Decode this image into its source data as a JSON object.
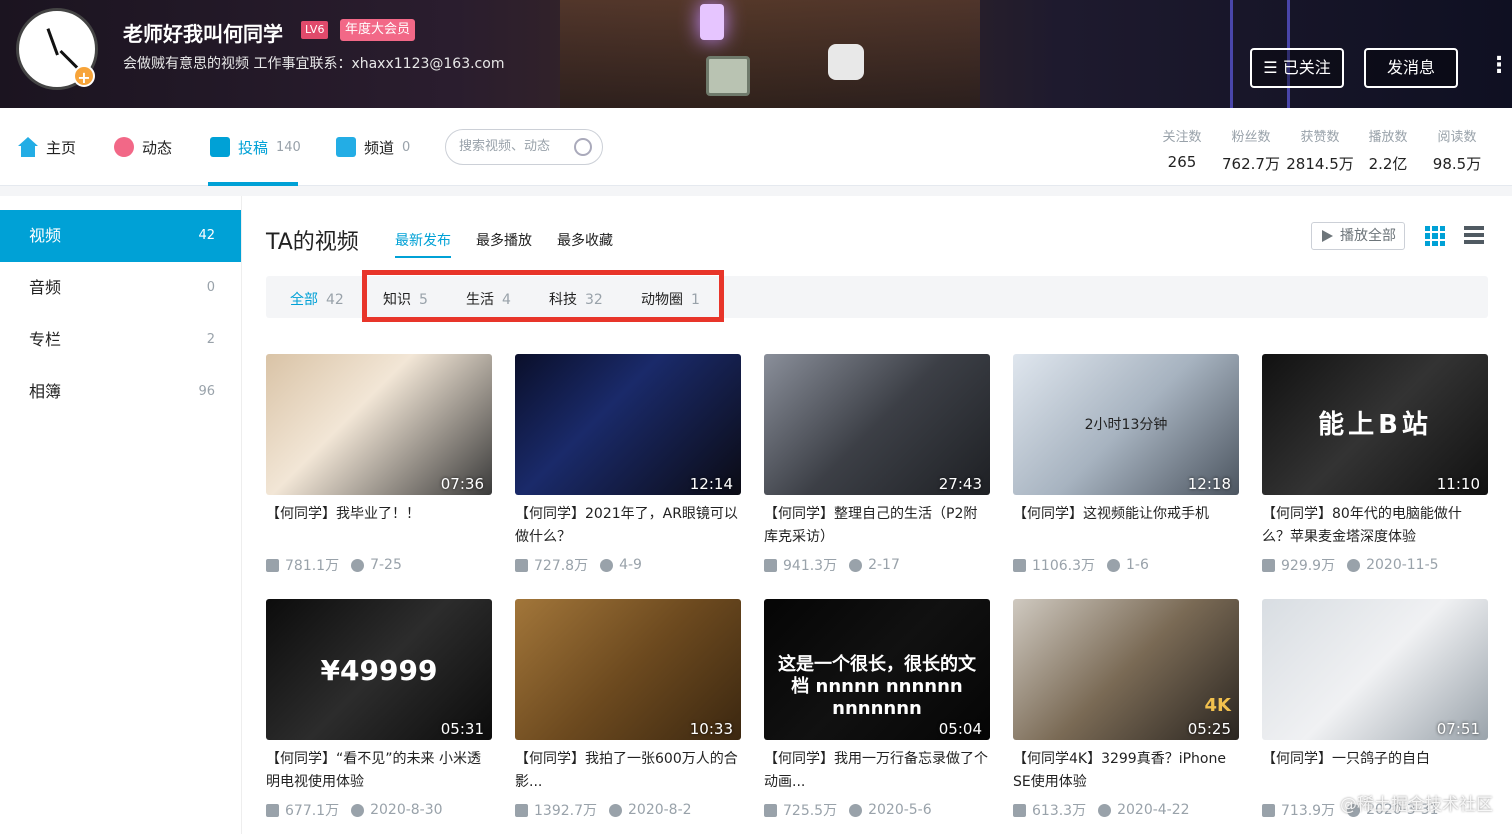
{
  "profile": {
    "name": "老师好我叫何同学",
    "level": "LV6",
    "vip": "年度大会员",
    "sign": "会做贼有意思的视频 工作事宜联系：xhaxx1123@163.com",
    "follow_label": "☰ 已关注",
    "message_label": "发消息",
    "more_label": "⋮"
  },
  "nav": {
    "home": "主页",
    "dynamic": "动态",
    "submit": "投稿",
    "submit_count": "140",
    "channel": "频道",
    "channel_count": "0",
    "search_placeholder": "搜索视频、动态"
  },
  "stats": [
    {
      "label": "关注数",
      "value": "265"
    },
    {
      "label": "粉丝数",
      "value": "762.7万"
    },
    {
      "label": "获赞数",
      "value": "2814.5万"
    },
    {
      "label": "播放数",
      "value": "2.2亿"
    },
    {
      "label": "阅读数",
      "value": "98.5万"
    }
  ],
  "sidebar": [
    {
      "label": "视频",
      "count": "42"
    },
    {
      "label": "音频",
      "count": "0"
    },
    {
      "label": "专栏",
      "count": "2"
    },
    {
      "label": "相簿",
      "count": "96"
    }
  ],
  "section": {
    "title": "TA的视频",
    "sorts": [
      "最新发布",
      "最多播放",
      "最多收藏"
    ],
    "play_all": "播放全部"
  },
  "filters": [
    {
      "label": "全部",
      "count": "42"
    },
    {
      "label": "知识",
      "count": "5"
    },
    {
      "label": "生活",
      "count": "4"
    },
    {
      "label": "科技",
      "count": "32"
    },
    {
      "label": "动物圈",
      "count": "1"
    }
  ],
  "videos": [
    {
      "title": "【何同学】我毕业了！！",
      "duration": "07:36",
      "plays": "781.1万",
      "date": "7-25"
    },
    {
      "title": "【何同学】2021年了，AR眼镜可以做什么？",
      "duration": "12:14",
      "plays": "727.8万",
      "date": "4-9"
    },
    {
      "title": "【何同学】整理自己的生活（P2附库克采访）",
      "duration": "27:43",
      "plays": "941.3万",
      "date": "2-17"
    },
    {
      "title": "【何同学】这视频能让你戒手机",
      "duration": "12:18",
      "plays": "1106.3万",
      "date": "1-6",
      "overlay": "2小时13分钟"
    },
    {
      "title": "【何同学】80年代的电脑能做什么？苹果麦金塔深度体验",
      "duration": "11:10",
      "plays": "929.9万",
      "date": "2020-11-5",
      "overlay": "能上B站"
    },
    {
      "title": "【何同学】“看不见”的未来 小米透明电视使用体验",
      "duration": "05:31",
      "plays": "677.1万",
      "date": "2020-8-30",
      "overlay": "¥49999"
    },
    {
      "title": "【何同学】我拍了一张600万人的合影...",
      "duration": "10:33",
      "plays": "1392.7万",
      "date": "2020-8-2"
    },
    {
      "title": "【何同学】我用一万行备忘录做了个动画...",
      "duration": "05:04",
      "plays": "725.5万",
      "date": "2020-5-6",
      "overlay": "这是一个很长，很长的文档 nnnnn nnnnnn nnnnnnn"
    },
    {
      "title": "【何同学4K】3299真香？iPhone SE使用体验",
      "duration": "05:25",
      "plays": "613.3万",
      "date": "2020-4-22",
      "overlay": "4K"
    },
    {
      "title": "【何同学】一只鸽子的自白",
      "duration": "07:51",
      "plays": "713.9万",
      "date": "2020-3-31"
    }
  ],
  "watermark": "@稀土掘金技术社区",
  "colors": {
    "accent": "#00a1d6",
    "highlight_box": "#e8352a",
    "vip": "#f26887"
  }
}
